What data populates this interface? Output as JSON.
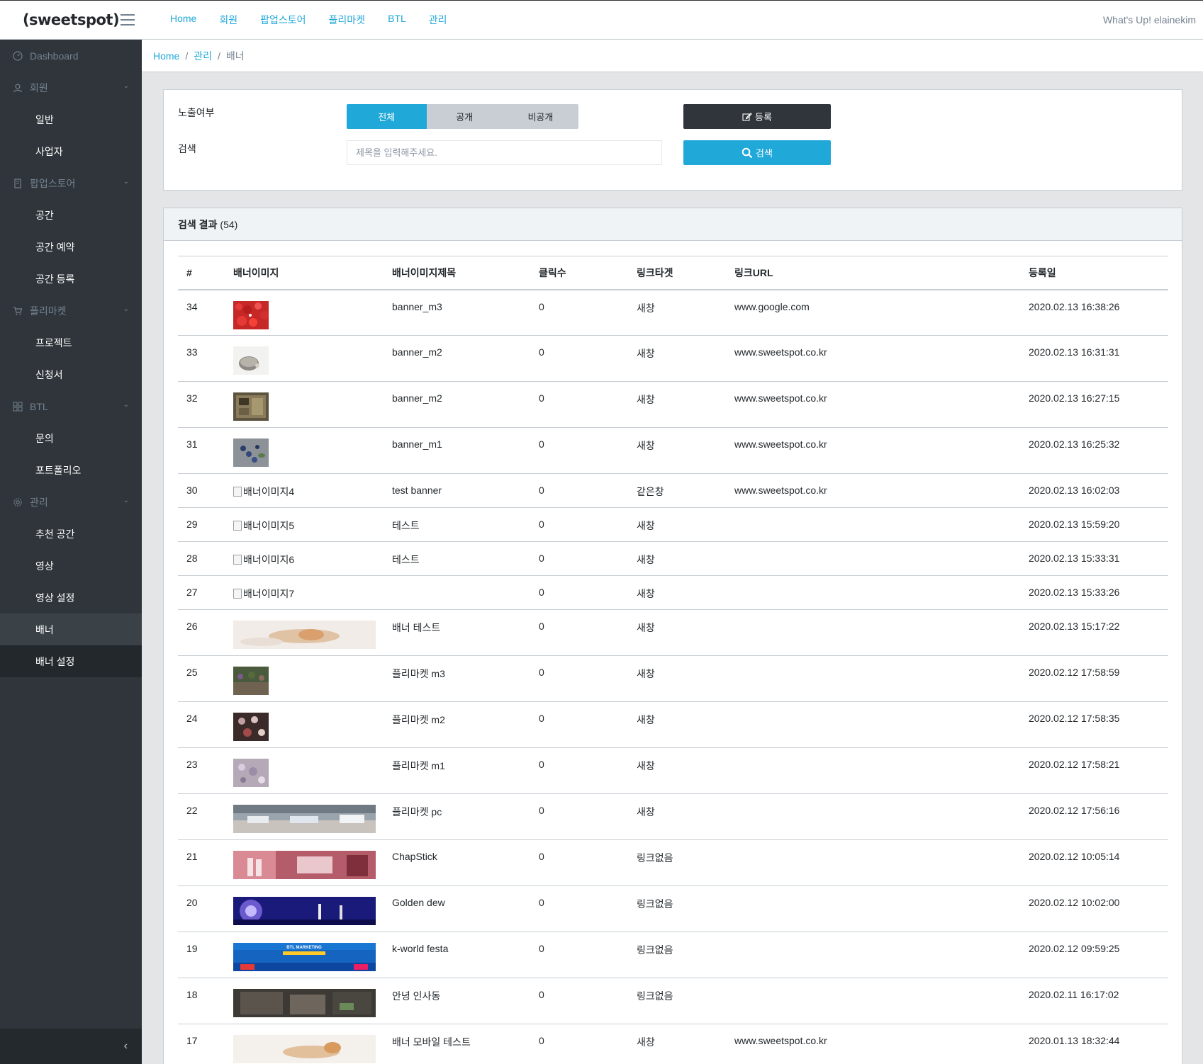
{
  "brand": "(sweetspot)",
  "topnav": [
    "Home",
    "회원",
    "팝업스토어",
    "플리마켓",
    "BTL",
    "관리"
  ],
  "greeting": "What's Up! elainekim",
  "sidebar": {
    "dashboard": "Dashboard",
    "groups": [
      {
        "label": "회원",
        "icon": "user-icon",
        "children": [
          "일반",
          "사업자"
        ]
      },
      {
        "label": "팝업스토어",
        "icon": "building-icon",
        "children": [
          "공간",
          "공간 예약",
          "공간 등록"
        ]
      },
      {
        "label": "플리마켓",
        "icon": "cart-icon",
        "children": [
          "프로젝트",
          "신청서"
        ]
      },
      {
        "label": "BTL",
        "icon": "grid-icon",
        "children": [
          "문의",
          "포트폴리오"
        ]
      },
      {
        "label": "관리",
        "icon": "gear-icon",
        "children": [
          "추천 공간",
          "영상",
          "영상 설정",
          "배너",
          "배너 설정"
        ]
      }
    ]
  },
  "breadcrumb": [
    "Home",
    "관리",
    "배너"
  ],
  "filter": {
    "exposure_label": "노출여부",
    "search_label": "검색",
    "toggle": [
      "전체",
      "공개",
      "비공개"
    ],
    "toggle_selected": "전체",
    "search_placeholder": "제목을 입력해주세요.",
    "register_label": "등록",
    "search_button": "검색"
  },
  "results": {
    "title": "검색 결과",
    "count": "(54)",
    "columns": [
      "#",
      "배너이미지",
      "배너이미지제목",
      "클릭수",
      "링크타겟",
      "링크URL",
      "등록일"
    ],
    "rows": [
      {
        "no": "34",
        "image": "thumb-strawberry",
        "title": "banner_m3",
        "clicks": "0",
        "target": "새창",
        "url": "www.google.com",
        "date": "2020.02.13 16:38:26"
      },
      {
        "no": "33",
        "image": "thumb-hedgehog",
        "title": "banner_m2",
        "clicks": "0",
        "target": "새창",
        "url": "www.sweetspot.co.kr",
        "date": "2020.02.13 16:31:31"
      },
      {
        "no": "32",
        "image": "thumb-machine",
        "title": "banner_m2",
        "clicks": "0",
        "target": "새창",
        "url": "www.sweetspot.co.kr",
        "date": "2020.02.13 16:27:15"
      },
      {
        "no": "31",
        "image": "thumb-berries",
        "title": "banner_m1",
        "clicks": "0",
        "target": "새창",
        "url": "www.sweetspot.co.kr",
        "date": "2020.02.13 16:25:32"
      },
      {
        "no": "30",
        "image": "broken",
        "alt": "배너이미지4",
        "title": "test banner",
        "clicks": "0",
        "target": "같은창",
        "url": "www.sweetspot.co.kr",
        "date": "2020.02.13 16:02:03"
      },
      {
        "no": "29",
        "image": "broken",
        "alt": "배너이미지5",
        "title": "테스트",
        "clicks": "0",
        "target": "새창",
        "url": "",
        "date": "2020.02.13 15:59:20"
      },
      {
        "no": "28",
        "image": "broken",
        "alt": "배너이미지6",
        "title": "테스트",
        "clicks": "0",
        "target": "새창",
        "url": "",
        "date": "2020.02.13 15:33:31"
      },
      {
        "no": "27",
        "image": "broken",
        "alt": "배너이미지7",
        "title": "",
        "clicks": "0",
        "target": "새창",
        "url": "",
        "date": "2020.02.13 15:33:26"
      },
      {
        "no": "26",
        "image": "wide-cat",
        "title": "배너 테스트",
        "clicks": "0",
        "target": "새창",
        "url": "",
        "date": "2020.02.13 15:17:22"
      },
      {
        "no": "25",
        "image": "thumb-market3",
        "title": "플리마켓 m3",
        "clicks": "0",
        "target": "새창",
        "url": "",
        "date": "2020.02.12 17:58:59"
      },
      {
        "no": "24",
        "image": "thumb-market2",
        "title": "플리마켓 m2",
        "clicks": "0",
        "target": "새창",
        "url": "",
        "date": "2020.02.12 17:58:35"
      },
      {
        "no": "23",
        "image": "thumb-market1",
        "title": "플리마켓 m1",
        "clicks": "0",
        "target": "새창",
        "url": "",
        "date": "2020.02.12 17:58:21"
      },
      {
        "no": "22",
        "image": "wide-market",
        "title": "플리마켓 pc",
        "clicks": "0",
        "target": "새창",
        "url": "",
        "date": "2020.02.12 17:56:16"
      },
      {
        "no": "21",
        "image": "wide-chapstick",
        "title": "ChapStick",
        "clicks": "0",
        "target": "링크없음",
        "url": "",
        "date": "2020.02.12 10:05:14"
      },
      {
        "no": "20",
        "image": "wide-stage",
        "title": "Golden dew",
        "clicks": "0",
        "target": "링크없음",
        "url": "",
        "date": "2020.02.12 10:02:00"
      },
      {
        "no": "19",
        "image": "wide-btl",
        "title": "k-world festa",
        "clicks": "0",
        "target": "링크없음",
        "url": "",
        "date": "2020.02.12 09:59:25"
      },
      {
        "no": "18",
        "image": "wide-insadong",
        "title": "안녕 인사동",
        "clicks": "0",
        "target": "링크없음",
        "url": "",
        "date": "2020.02.11 16:17:02"
      },
      {
        "no": "17",
        "image": "wide-cat2",
        "title": "배너 모바일 테스트",
        "clicks": "0",
        "target": "새창",
        "url": "www.sweetspot.co.kr",
        "date": "2020.01.13 18:32:44"
      }
    ]
  },
  "thumb_text": {
    "btl_banner": "BTL MARKETING"
  },
  "colors": {
    "primary": "#20a8d8",
    "sidebar": "#2f353a",
    "dark_button": "#2f353a"
  }
}
